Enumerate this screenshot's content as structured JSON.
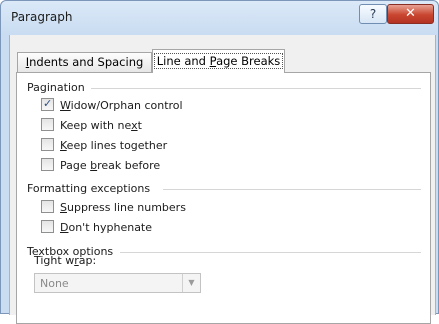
{
  "window": {
    "title": "Paragraph",
    "help_glyph": "?",
    "close_glyph": "✕"
  },
  "tabs": [
    {
      "label_pre": "",
      "label_key": "I",
      "label_post": "ndents and Spacing",
      "selected": false
    },
    {
      "label_pre": "Line and ",
      "label_key": "P",
      "label_post": "age Breaks",
      "selected": true
    }
  ],
  "pagination": {
    "title": "Pagination",
    "options": [
      {
        "pre": "",
        "key": "W",
        "post": "idow/Orphan control",
        "checked": true
      },
      {
        "pre": "Keep with ne",
        "key": "x",
        "post": "t",
        "checked": false
      },
      {
        "pre": "",
        "key": "K",
        "post": "eep lines together",
        "checked": false
      },
      {
        "pre": "Page ",
        "key": "b",
        "post": "reak before",
        "checked": false
      }
    ]
  },
  "formatting": {
    "title": "Formatting exceptions",
    "options": [
      {
        "pre": "",
        "key": "S",
        "post": "uppress line numbers",
        "checked": false
      },
      {
        "pre": "",
        "key": "D",
        "post": "on't hyphenate",
        "checked": false
      }
    ]
  },
  "textbox": {
    "title": "Textbox options",
    "tight_wrap_pre": "Tight w",
    "tight_wrap_key": "r",
    "tight_wrap_post": "ap:",
    "tight_wrap_value": "None"
  },
  "icons": {
    "check": "check-mark-icon",
    "dropdown": "chevron-down-icon"
  }
}
